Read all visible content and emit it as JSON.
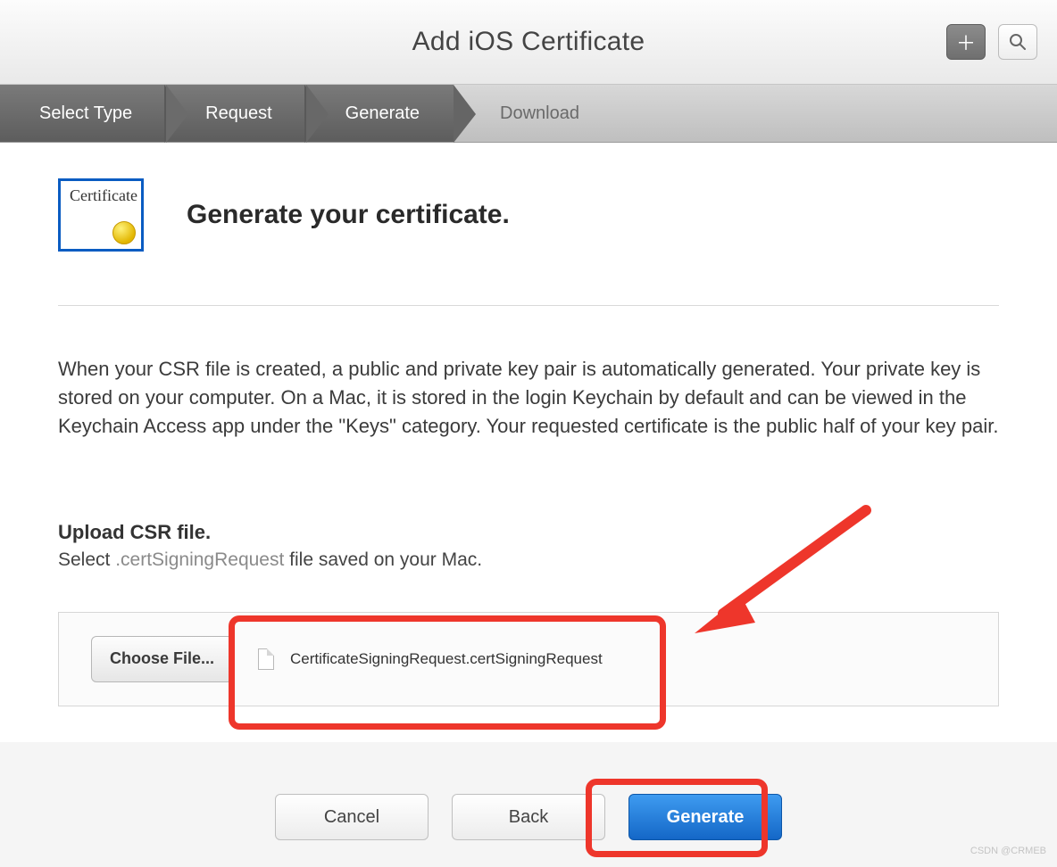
{
  "header": {
    "title": "Add iOS Certificate"
  },
  "steps": {
    "s1": "Select Type",
    "s2": "Request",
    "s3": "Generate",
    "s4": "Download"
  },
  "page": {
    "cert_badge_text": "Certificate",
    "heading": "Generate your certificate.",
    "description": "When your CSR file is created, a public and private key pair is automatically generated. Your private key is stored on your computer. On a Mac, it is stored in the login Keychain by default and can be viewed in the Keychain Access app under the \"Keys\" category. Your requested certificate is the public half of your key pair.",
    "upload_title": "Upload CSR file.",
    "upload_sub_prefix": "Select ",
    "upload_sub_ext": ".certSigningRequest",
    "upload_sub_suffix": " file saved on your Mac.",
    "choose_file_label": "Choose File...",
    "selected_file_name": "CertificateSigningRequest.certSigningRequest"
  },
  "footer": {
    "cancel": "Cancel",
    "back": "Back",
    "generate": "Generate"
  },
  "watermark": "CSDN @CRMEB"
}
